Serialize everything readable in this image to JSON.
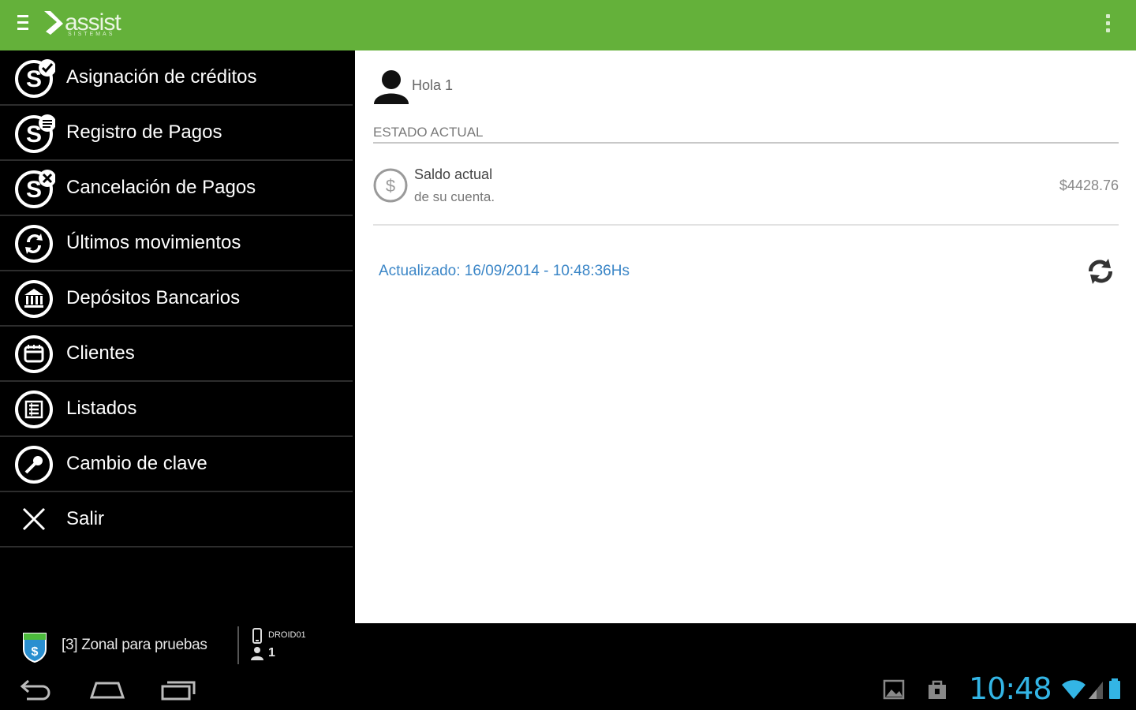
{
  "app": {
    "logo_text": "assist",
    "logo_subtext": "SISTEMAS",
    "brand_color": "#64b13a"
  },
  "menu": {
    "items": [
      {
        "label": "Asignación de créditos",
        "icon": "credit-assign-icon"
      },
      {
        "label": "Registro de Pagos",
        "icon": "payment-register-icon"
      },
      {
        "label": "Cancelación de Pagos",
        "icon": "payment-cancel-icon"
      },
      {
        "label": "Últimos movimientos",
        "icon": "movements-icon"
      },
      {
        "label": "Depósitos Bancarios",
        "icon": "bank-icon"
      },
      {
        "label": "Clientes",
        "icon": "clients-icon"
      },
      {
        "label": "Listados",
        "icon": "list-icon"
      },
      {
        "label": "Cambio de clave",
        "icon": "key-icon"
      },
      {
        "label": "Salir",
        "icon": "close-icon"
      }
    ]
  },
  "footer": {
    "zone_label": "[3] Zonal para pruebas",
    "device_label": "DROID01",
    "user_label": "1"
  },
  "main": {
    "greeting": "Hola 1",
    "section_title": "ESTADO ACTUAL",
    "balance": {
      "title": "Saldo actual",
      "subtitle": "de su cuenta.",
      "amount": "$4428.76"
    },
    "updated_text": "Actualizado: 16/09/2014 - 10:48:36Hs",
    "accent_color": "#3b86c7"
  },
  "status_bar": {
    "time": "10:48",
    "accent_color": "#33b5e5"
  }
}
